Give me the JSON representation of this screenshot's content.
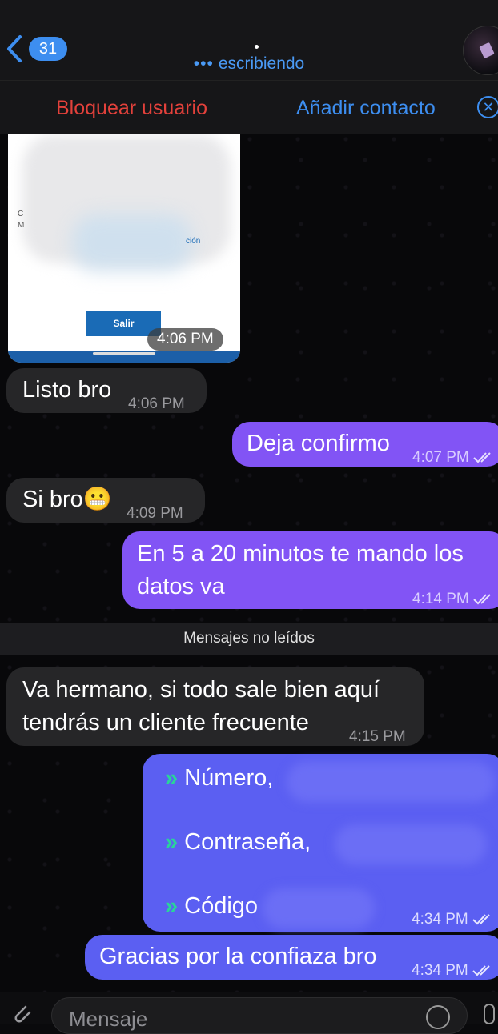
{
  "header": {
    "back_count": "31",
    "status": "escribiendo",
    "status_dots": "•••"
  },
  "actions": {
    "block": "Bloquear usuario",
    "add": "Añadir contacto"
  },
  "image_message": {
    "button_label": "Salir",
    "time": "4:06 PM",
    "fragment_text": "ción",
    "fragment_c": "C",
    "fragment_m": "M"
  },
  "messages": [
    {
      "dir": "in",
      "text": "Listo bro",
      "time": "4:06 PM"
    },
    {
      "dir": "out",
      "text": "Deja confirmo",
      "time": "4:07 PM"
    },
    {
      "dir": "in",
      "text": "Si bro😬",
      "time": "4:09 PM"
    },
    {
      "dir": "out",
      "text": "En 5 a 20 minutos te mando los datos va",
      "time": "4:14 PM"
    },
    {
      "dir": "in",
      "text": "Va hermano, si todo sale bien aquí tendrás un cliente frecuente",
      "time": "4:15 PM"
    }
  ],
  "unread_label": "Mensajes no leídos",
  "list_message": {
    "arrow": "»",
    "item1": "Número,",
    "item2": "Contraseña,",
    "item3": "Código",
    "time": "4:34 PM"
  },
  "last_message": {
    "text": "Gracias por la confiaza bro",
    "time": "4:34 PM"
  },
  "input": {
    "placeholder": "Mensaje"
  }
}
